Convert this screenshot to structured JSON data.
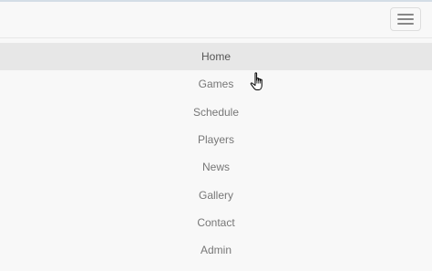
{
  "navbar": {
    "toggle_icon": "hamburger-menu-icon",
    "items": [
      {
        "label": "Home",
        "active": true
      },
      {
        "label": "Games"
      },
      {
        "label": "Schedule"
      },
      {
        "label": "Players"
      },
      {
        "label": "News"
      },
      {
        "label": "Gallery"
      },
      {
        "label": "Contact"
      },
      {
        "label": "Admin"
      }
    ]
  },
  "cursor_icon": "hand-pointer-icon",
  "colors": {
    "background": "#f8f8f8",
    "active_item": "#e7e7e7",
    "link_text": "#777777",
    "active_text": "#555555",
    "border": "#e7e7e7"
  }
}
